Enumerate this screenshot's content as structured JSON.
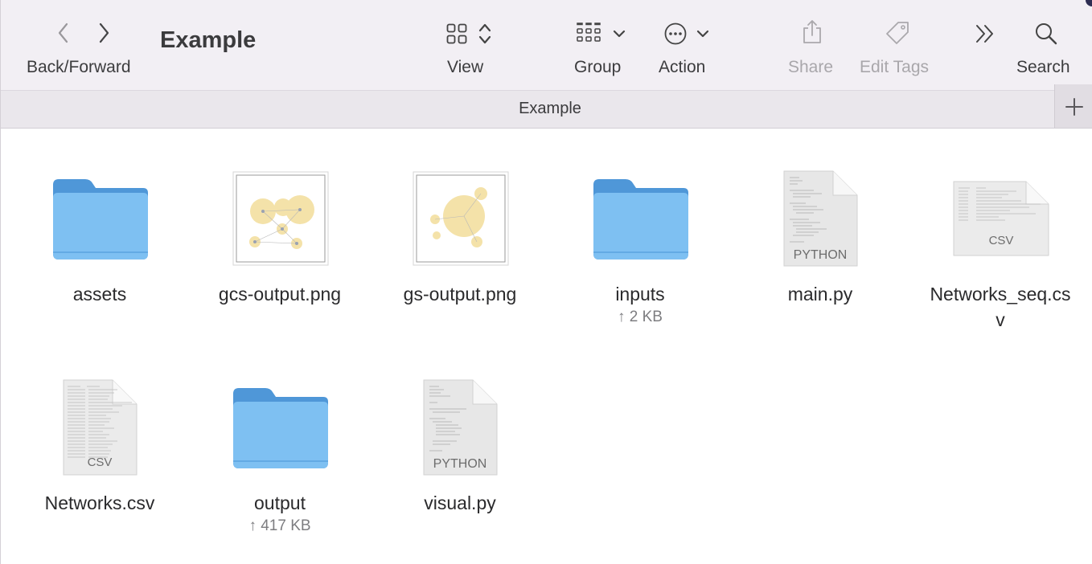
{
  "window": {
    "title": "Example",
    "path_label": "Example"
  },
  "toolbar": {
    "nav_label": "Back/Forward",
    "view_label": "View",
    "group_label": "Group",
    "action_label": "Action",
    "share_label": "Share",
    "edit_tags_label": "Edit Tags",
    "search_label": "Search"
  },
  "files": [
    {
      "name": "assets",
      "kind": "folder",
      "sub": ""
    },
    {
      "name": "gcs-output.png",
      "kind": "image",
      "sub": ""
    },
    {
      "name": "gs-output.png",
      "kind": "image",
      "sub": ""
    },
    {
      "name": "inputs",
      "kind": "folder",
      "sub": "↑ 2 KB"
    },
    {
      "name": "main.py",
      "kind": "python",
      "sub": "",
      "badge": "PYTHON"
    },
    {
      "name": "Networks_seq.cs",
      "name2": "v",
      "kind": "csv",
      "sub": "",
      "badge": "CSV"
    },
    {
      "name": "Networks.csv",
      "kind": "csv",
      "sub": "",
      "badge": "CSV"
    },
    {
      "name": "output",
      "kind": "folder",
      "sub": "↑ 417 KB"
    },
    {
      "name": "visual.py",
      "kind": "python",
      "sub": "",
      "badge": "PYTHON"
    }
  ],
  "colors": {
    "folder_back": "#4d96d8",
    "folder_front": "#7fc0f2",
    "toolbar_bg": "#f2eff4"
  },
  "icons": [
    "chevron-left-icon",
    "chevron-right-icon",
    "grid-icon",
    "sort-arrows-icon",
    "group-grid-icon",
    "chevron-down-icon",
    "ellipsis-circle-icon",
    "share-icon",
    "tag-icon",
    "double-chevron-icon",
    "search-icon",
    "plus-icon"
  ]
}
